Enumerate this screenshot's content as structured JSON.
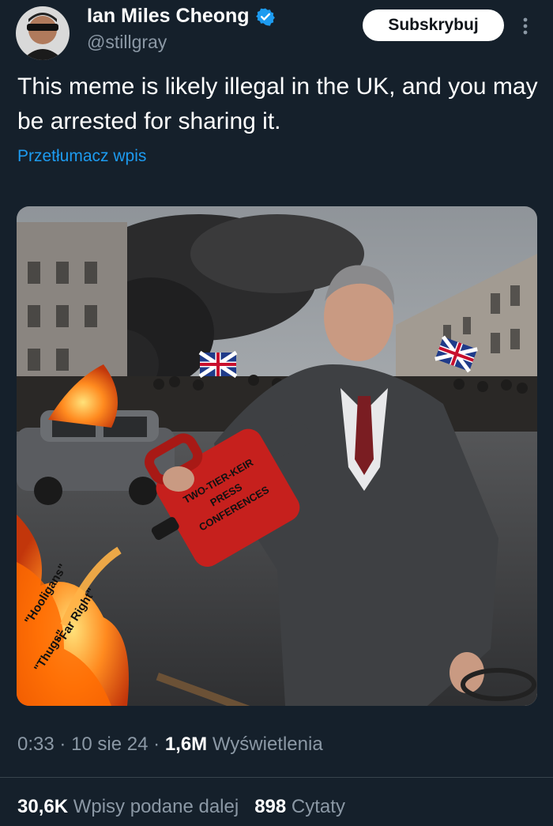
{
  "author": {
    "name": "Ian Miles Cheong",
    "handle": "@stillgray",
    "verified": true,
    "avatar_icon": "avatar-sunglasses-man"
  },
  "header": {
    "subscribe_label": "Subskrybuj"
  },
  "post": {
    "text": "This meme is likely illegal in the UK, and you may be arrested for sharing it.",
    "translate_label": "Przetłumacz wpis"
  },
  "media": {
    "can_label": [
      "TWO-TIER-KEIR",
      "PRESS",
      "CONFERENCES"
    ],
    "flame_labels": [
      "\"Hooligans\"",
      "\"Far Right\"",
      "\"Thugs\""
    ]
  },
  "meta": {
    "time": "0:33",
    "date": "10 sie 24",
    "views_count": "1,6M",
    "views_label": "Wyświetlenia",
    "sep": "·"
  },
  "stats": {
    "reposts_count": "30,6K",
    "reposts_label": "Wpisy podane dalej",
    "quotes_count": "898",
    "quotes_label": "Cytaty"
  },
  "colors": {
    "background": "#15202b",
    "link": "#1d9bf0",
    "muted": "#8b98a5",
    "verified": "#1d9bf0"
  }
}
